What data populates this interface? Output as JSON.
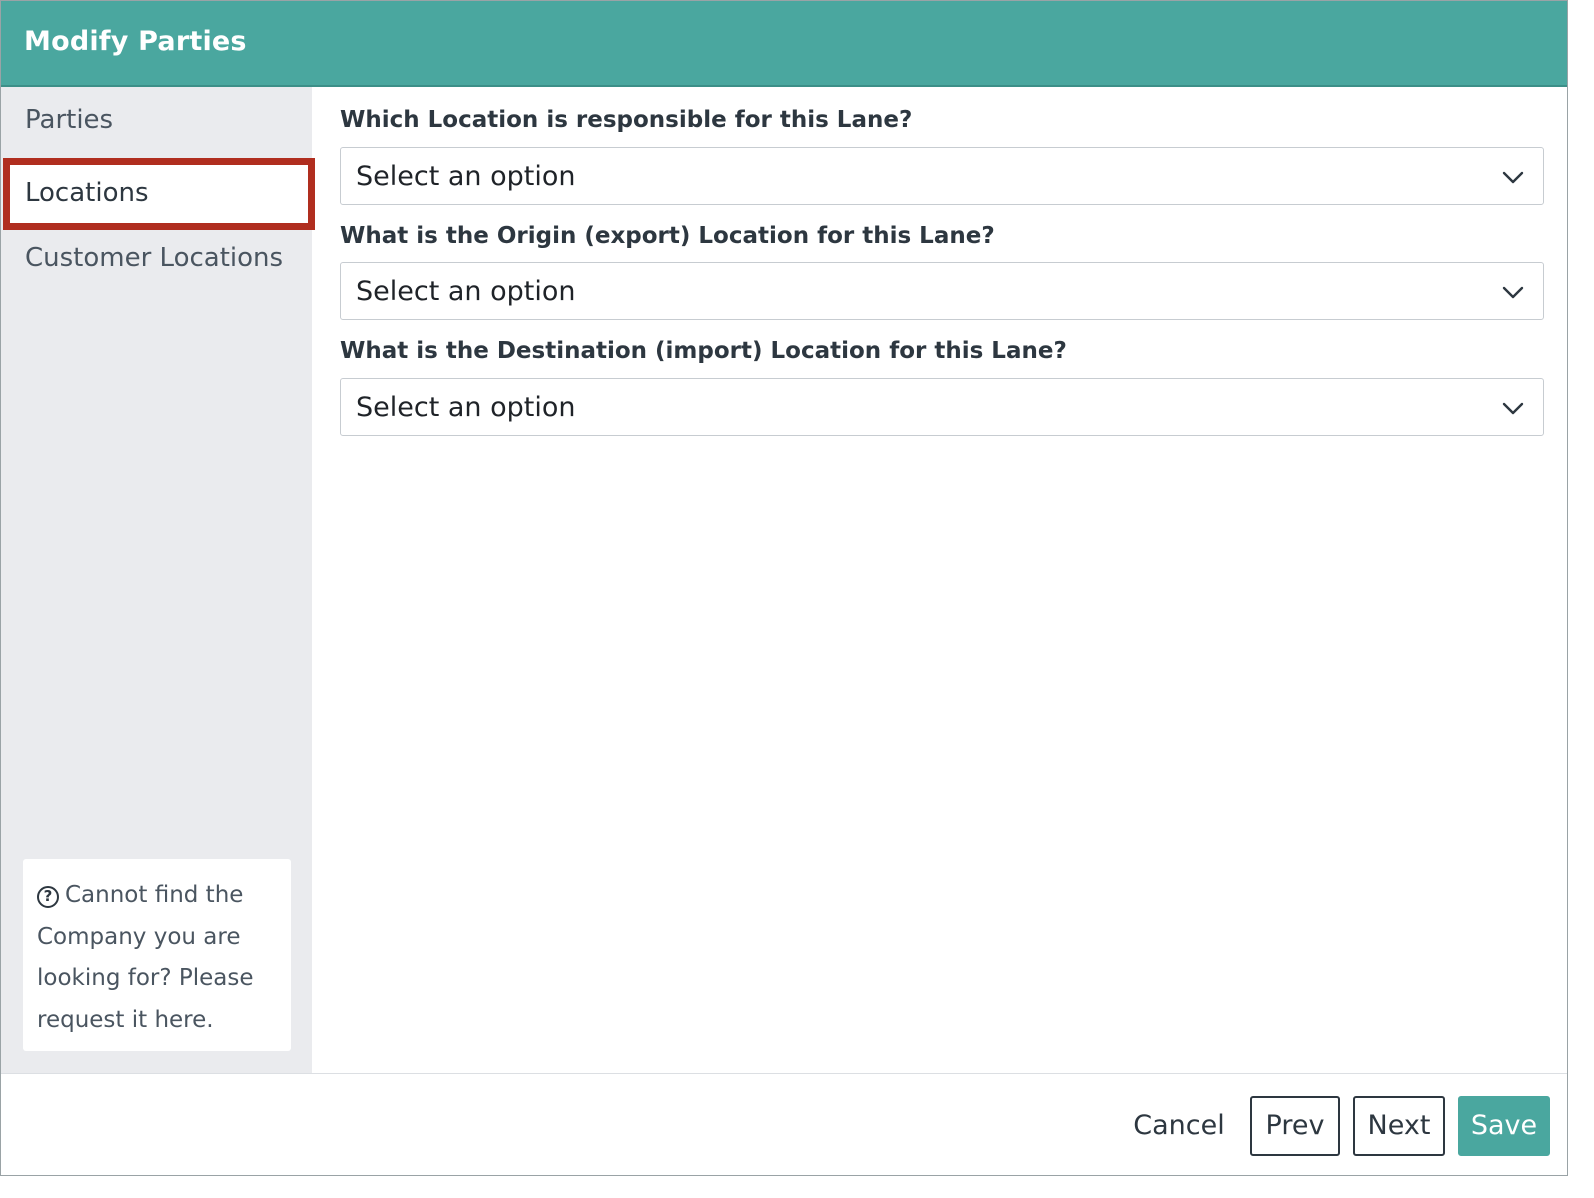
{
  "header": {
    "title": "Modify Parties"
  },
  "sidebar": {
    "items": [
      {
        "label": "Parties",
        "active": false
      },
      {
        "label": "Locations",
        "active": true
      },
      {
        "label": "Customer Locations",
        "active": false
      }
    ],
    "help": {
      "icon": "question-circle-icon",
      "text": "Cannot find the Company you are looking for? Please request it here."
    }
  },
  "form": {
    "fields": [
      {
        "label": "Which Location is responsible for this Lane?",
        "value": "Select an option"
      },
      {
        "label": "What is the Origin (export) Location for this Lane?",
        "value": "Select an option"
      },
      {
        "label": "What is the Destination (import) Location for this Lane?",
        "value": "Select an option"
      }
    ]
  },
  "footer": {
    "cancel_label": "Cancel",
    "prev_label": "Prev",
    "next_label": "Next",
    "save_label": "Save"
  },
  "colors": {
    "header_bg": "#4aa79f",
    "active_border": "#b02e1f",
    "sidebar_bg": "#eaebee",
    "save_bg": "#4aa79f"
  }
}
